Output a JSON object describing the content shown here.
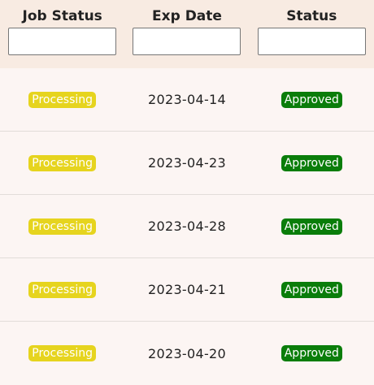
{
  "header": {
    "columns": [
      {
        "label": "Job Status",
        "filter_value": ""
      },
      {
        "label": "Exp Date",
        "filter_value": ""
      },
      {
        "label": "Status",
        "filter_value": ""
      }
    ]
  },
  "rows": [
    {
      "job_status": "Processing",
      "exp_date": "2023-04-14",
      "status": "Approved"
    },
    {
      "job_status": "Processing",
      "exp_date": "2023-04-23",
      "status": "Approved"
    },
    {
      "job_status": "Processing",
      "exp_date": "2023-04-28",
      "status": "Approved"
    },
    {
      "job_status": "Processing",
      "exp_date": "2023-04-21",
      "status": "Approved"
    },
    {
      "job_status": "Processing",
      "exp_date": "2023-04-20",
      "status": "Approved"
    }
  ],
  "colors": {
    "header_bg": "#f8ebe2",
    "row_bg": "#fcf5f3",
    "processing_badge": "#e6d41e",
    "approved_badge": "#0a7d0a"
  }
}
